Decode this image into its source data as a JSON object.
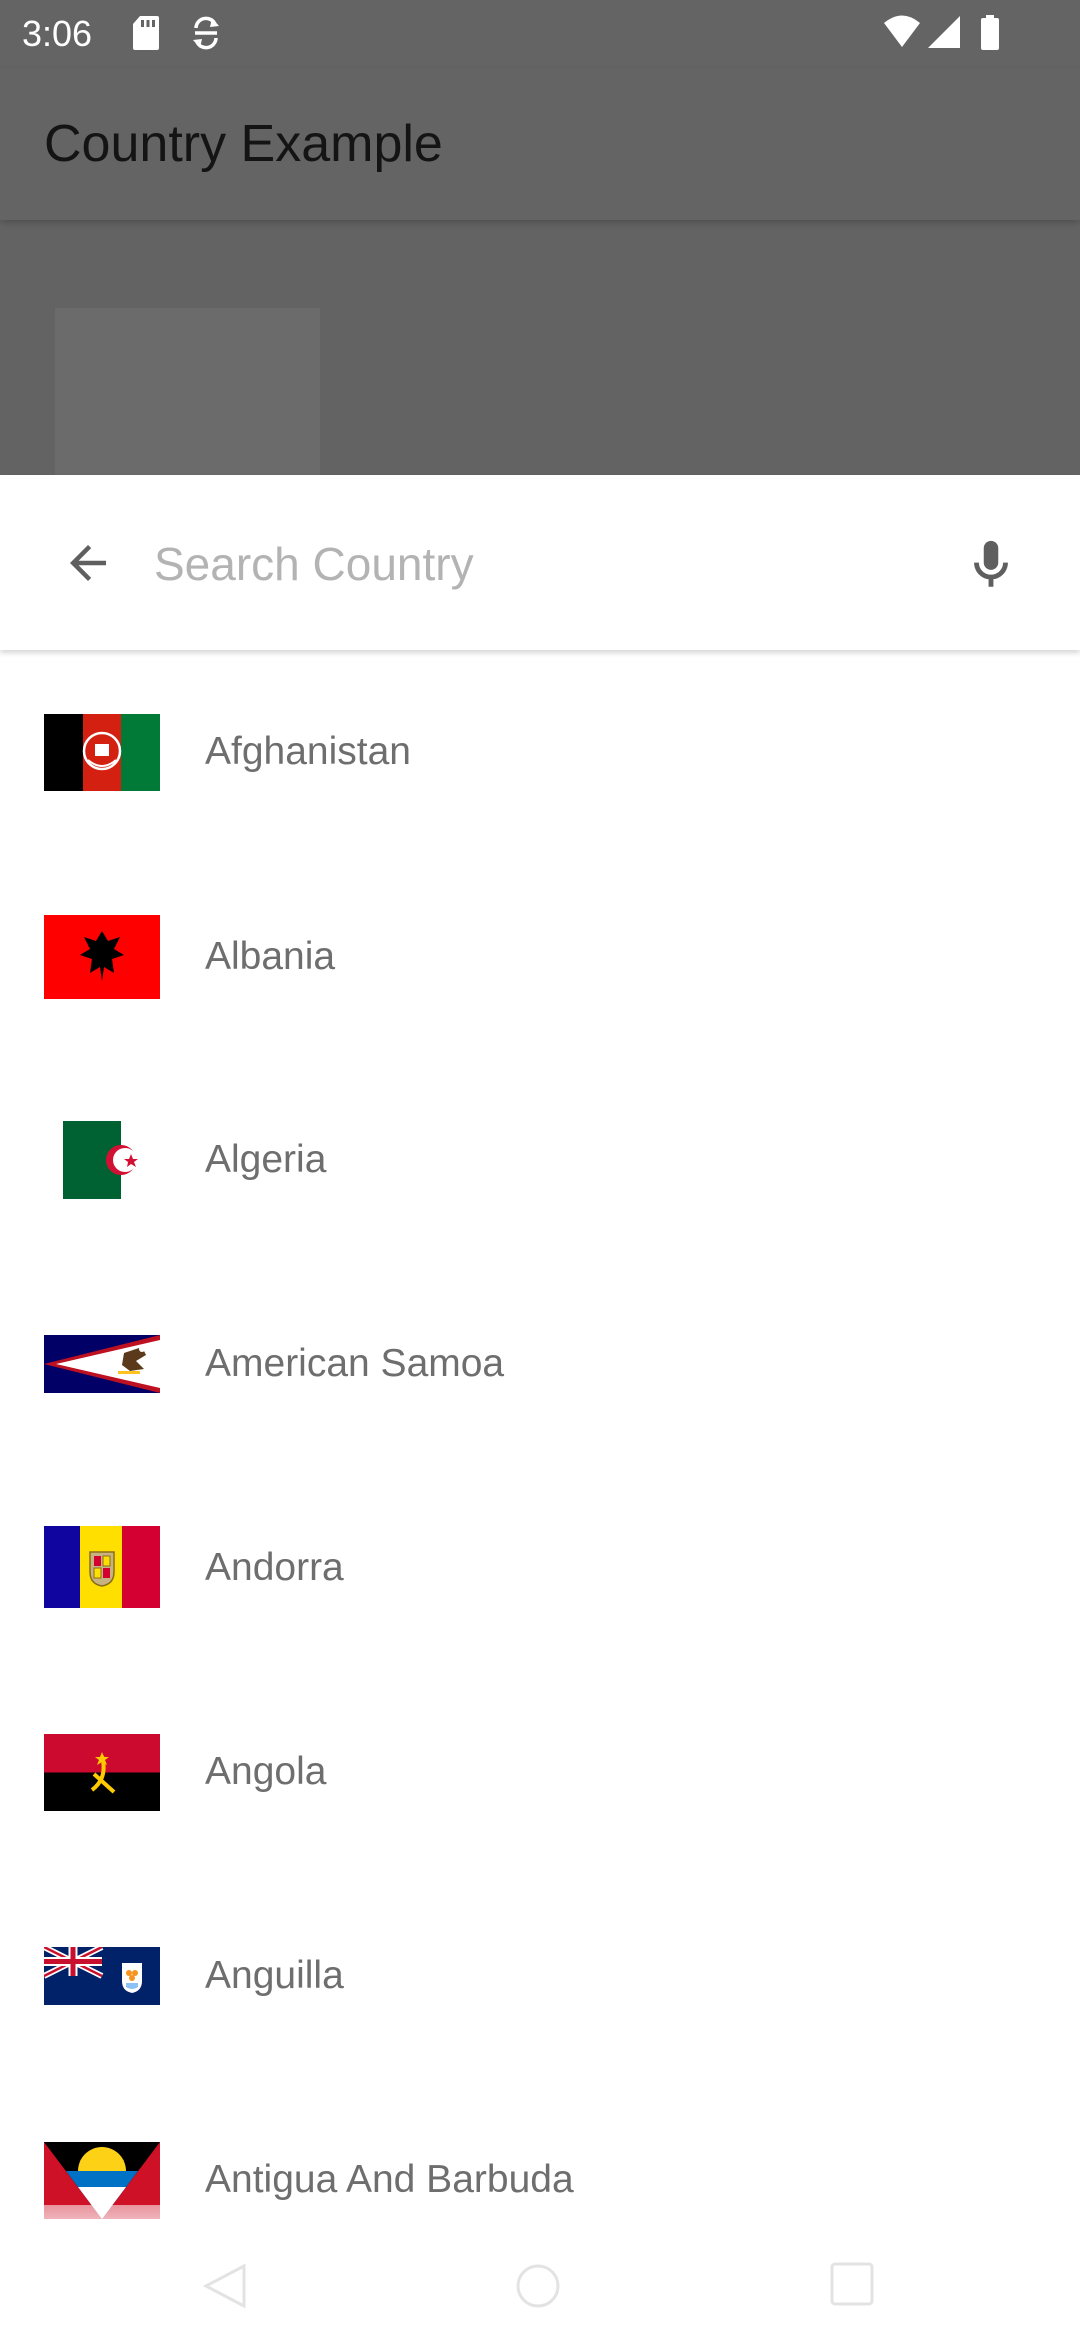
{
  "status_bar": {
    "time": "3:06",
    "icons": [
      "sd-card-icon",
      "sync-icon",
      "wifi-icon",
      "cellular-signal-icon",
      "battery-icon"
    ]
  },
  "app_bar": {
    "title": "Country Example"
  },
  "search": {
    "placeholder": "Search Country",
    "value": "",
    "back_icon": "arrow-back-icon",
    "mic_icon": "microphone-icon"
  },
  "countries": [
    {
      "name": "Afghanistan",
      "flag": "afghanistan-flag"
    },
    {
      "name": "Albania",
      "flag": "albania-flag"
    },
    {
      "name": "Algeria",
      "flag": "algeria-flag"
    },
    {
      "name": "American Samoa",
      "flag": "american-samoa-flag"
    },
    {
      "name": "Andorra",
      "flag": "andorra-flag"
    },
    {
      "name": "Angola",
      "flag": "angola-flag"
    },
    {
      "name": "Anguilla",
      "flag": "anguilla-flag"
    },
    {
      "name": "Antigua And Barbuda",
      "flag": "antigua-and-barbuda-flag"
    }
  ],
  "nav_bar": {
    "icons": [
      "nav-back-icon",
      "nav-home-icon",
      "nav-recents-icon"
    ]
  },
  "colors": {
    "scrim": "#646464",
    "surface": "#ffffff",
    "text_secondary": "#6e6e6e",
    "placeholder": "#b3b3b3"
  }
}
